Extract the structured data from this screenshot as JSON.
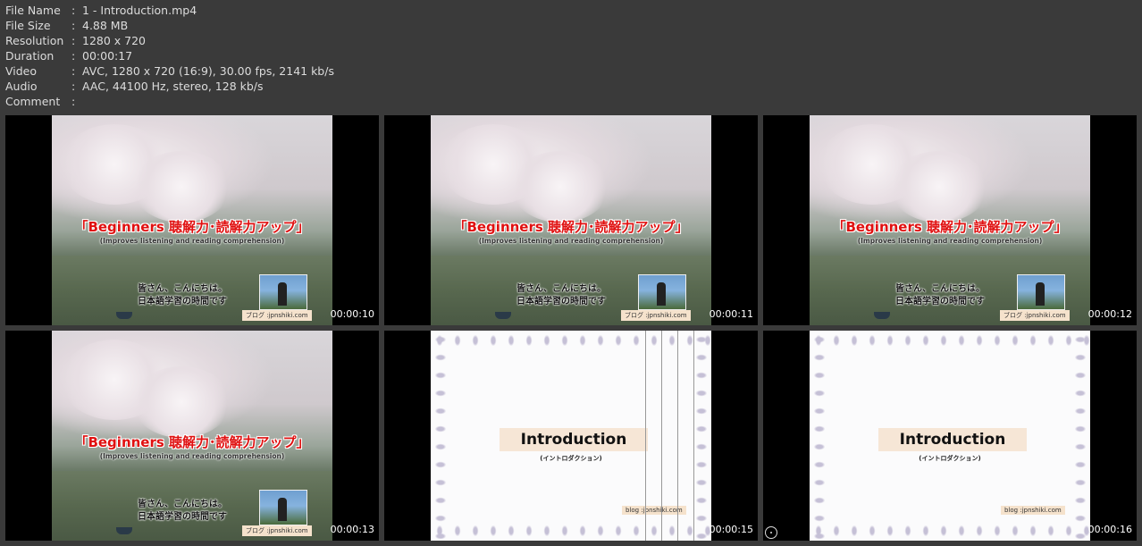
{
  "info": [
    {
      "key": "File Name",
      "sep": ":",
      "value": "1 - Introduction.mp4"
    },
    {
      "key": "File Size",
      "sep": ":",
      "value": "4.88 MB"
    },
    {
      "key": "Resolution",
      "sep": ":",
      "value": "1280 x 720"
    },
    {
      "key": "Duration",
      "sep": ":",
      "value": "00:00:17"
    },
    {
      "key": "Video",
      "sep": ":",
      "value": "AVC, 1280 x 720 (16:9), 30.00 fps, 2141 kb/s"
    },
    {
      "key": "Audio",
      "sep": ":",
      "value": "AAC, 44100 Hz, stereo, 128 kb/s"
    },
    {
      "key": "Comment",
      "sep": ":",
      "value": ""
    }
  ],
  "frame_text": {
    "photo_title": "「Beginners 聴解力･読解力アップ」",
    "photo_subtitle": "(Improves listening and reading comprehension)",
    "photo_greeting_line1": "皆さん、こんにちは。",
    "photo_greeting_line2": "日本語学習の時間です",
    "photo_badge": "ブログ :jpnshiki.com",
    "intro_title": "Introduction",
    "intro_subtitle": "(イントロダクション)",
    "intro_badge": "blog :jpnshiki.com"
  },
  "thumbnails": [
    {
      "time": "00:00:10"
    },
    {
      "time": "00:00:11"
    },
    {
      "time": "00:00:12"
    },
    {
      "time": "00:00:13"
    },
    {
      "time": "00:00:15"
    },
    {
      "time": "00:00:16"
    }
  ],
  "colors": {
    "background": "#3a3a3a",
    "info_text": "#dcdcdc",
    "title_red": "#e01010",
    "badge_bg": "#f5e2cc"
  }
}
